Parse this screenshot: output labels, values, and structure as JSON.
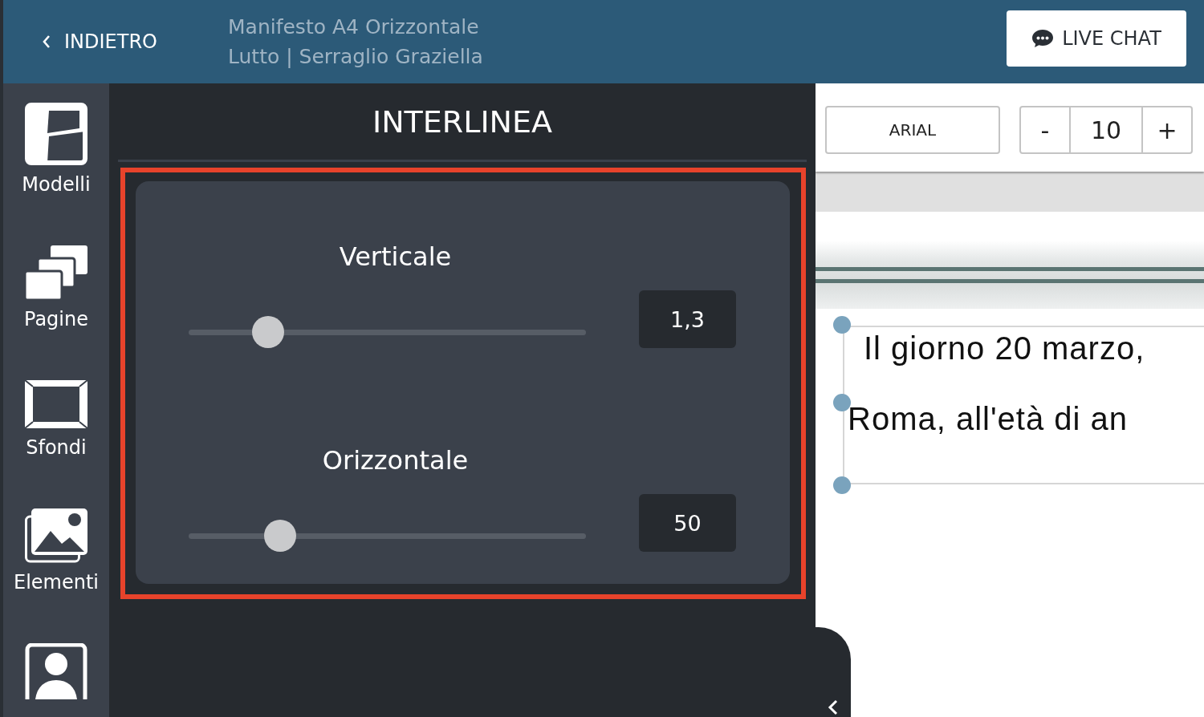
{
  "header": {
    "back_label": "INDIETRO",
    "title": "Manifesto A4 Orizzontale",
    "subtitle": "Lutto | Serraglio Graziella",
    "chat_button": "LIVE CHAT"
  },
  "sidebar": {
    "items": [
      {
        "kind": "templates",
        "label": "Modelli"
      },
      {
        "kind": "pages",
        "label": "Pagine"
      },
      {
        "kind": "backgrounds",
        "label": "Sfondi"
      },
      {
        "kind": "elements",
        "label": "Elementi"
      },
      {
        "kind": "person"
      }
    ]
  },
  "panel": {
    "title": "INTERLINEA",
    "sliders": [
      {
        "label": "Verticale",
        "level": 0.2,
        "value": "1,3"
      },
      {
        "label": "Orizzontale",
        "level": 0.23,
        "value": "50"
      }
    ]
  },
  "toolbar": {
    "font": "ARIAL",
    "decrease": "-",
    "size": "10",
    "increase": "+"
  },
  "canvas": {
    "lines": [
      "Il giorno 20 marzo,",
      "Roma, all'età di an"
    ]
  }
}
